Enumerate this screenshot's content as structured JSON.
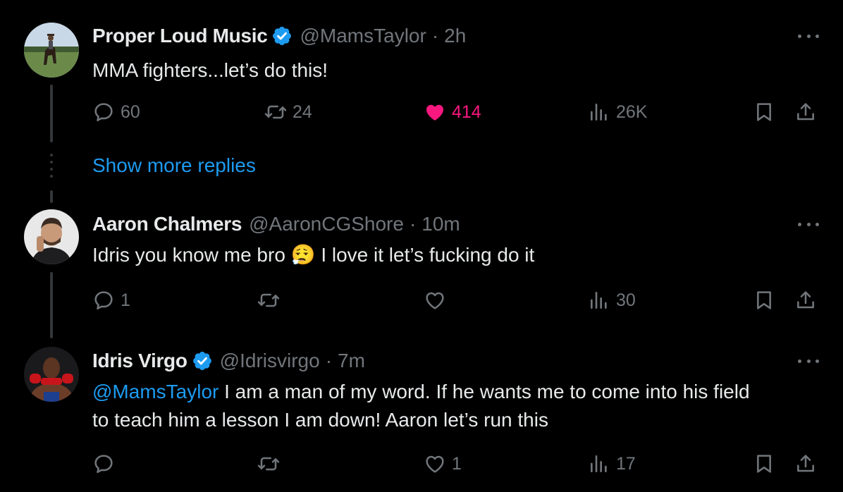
{
  "tweets": [
    {
      "name": "Proper Loud Music",
      "verified": true,
      "handle": "@MamsTaylor",
      "separator": "·",
      "time": "2h",
      "text": "MMA fighters...let’s do this!",
      "replies": "60",
      "retweets": "24",
      "likes": "414",
      "liked": true,
      "views": "26K"
    },
    {
      "name": "Aaron Chalmers",
      "verified": false,
      "handle": "@AaronCGShore",
      "separator": "·",
      "time": "10m",
      "text_before_emoji": "Idris you know me bro",
      "emoji": "😮‍💨",
      "text_after_emoji": "I love it let’s fucking do it",
      "replies": "1",
      "retweets": "",
      "likes": "",
      "views": "30"
    },
    {
      "name": "Idris Virgo",
      "verified": true,
      "handle": "@Idrisvirgo",
      "separator": "·",
      "time": "7m",
      "mention": "@MamsTaylor",
      "text_line1": " I am a man of my word. If he wants me to come into his field",
      "text_line2": "to teach him a lesson I am down! Aaron let’s run this",
      "replies": "",
      "retweets": "",
      "likes": "1",
      "views": "17"
    }
  ],
  "show_more_replies": "Show more replies",
  "icons": {
    "reply": "reply-icon",
    "retweet": "retweet-icon",
    "like": "heart-icon",
    "views": "views-icon",
    "bookmark": "bookmark-icon",
    "share": "share-icon",
    "verified": "verified-badge-icon",
    "more": "more-options-icon"
  },
  "colors": {
    "background": "#000000",
    "text": "#e7e9ea",
    "muted": "#71767b",
    "accent": "#1d9bf0",
    "like": "#f91880"
  }
}
